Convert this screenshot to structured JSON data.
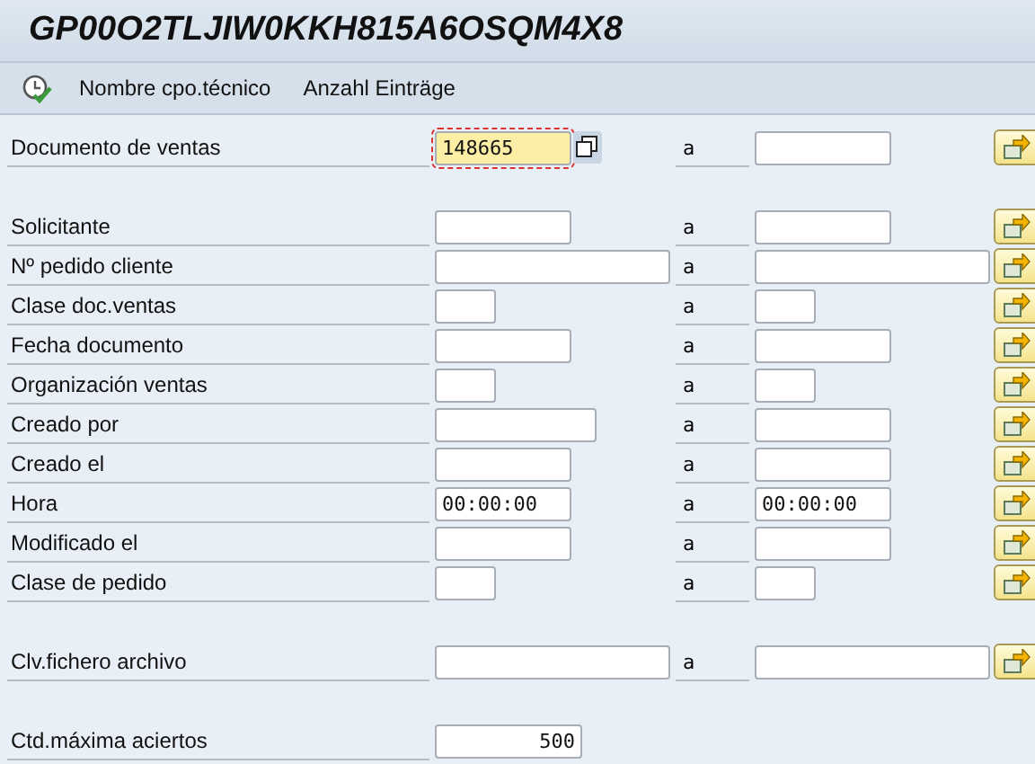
{
  "window": {
    "title": "GP00O2TLJIW0KKH815A6OSQM4X8"
  },
  "toolbar": {
    "items": [
      {
        "kind": "icon"
      },
      {
        "kind": "text",
        "label": "Nombre cpo.técnico"
      },
      {
        "kind": "text",
        "label": "Anzahl Einträge"
      }
    ]
  },
  "sections": [
    {
      "rows": [
        {
          "kind": "range",
          "label": "Documento de ventas",
          "from": "148665",
          "to_label": "a",
          "to": "",
          "focused": true
        }
      ]
    },
    {
      "rows": [
        {
          "kind": "range",
          "label": "Solicitante",
          "from": "",
          "to_label": "a",
          "to": "",
          "focused": false
        },
        {
          "kind": "range",
          "label": "Nº pedido cliente",
          "from": "",
          "to_label": "a",
          "to": "",
          "focused": false
        },
        {
          "kind": "range",
          "label": "Clase doc.ventas",
          "from": "",
          "to_label": "a",
          "to": "",
          "focused": false
        },
        {
          "kind": "range",
          "label": "Fecha documento",
          "from": "",
          "to_label": "a",
          "to": "",
          "focused": false
        },
        {
          "kind": "range",
          "label": "Organización ventas",
          "from": "",
          "to_label": "a",
          "to": "",
          "focused": false
        },
        {
          "kind": "range",
          "label": "Creado por",
          "from": "",
          "to_label": "a",
          "to": "",
          "focused": false
        },
        {
          "kind": "range",
          "label": "Creado el",
          "from": "",
          "to_label": "a",
          "to": "",
          "focused": false
        },
        {
          "kind": "range",
          "label": "Hora",
          "from": "00:00:00",
          "to_label": "a",
          "to": "00:00:00",
          "focused": false
        },
        {
          "kind": "range",
          "label": "Modificado el",
          "from": "",
          "to_label": "a",
          "to": "",
          "focused": false
        },
        {
          "kind": "range",
          "label": "Clase de pedido",
          "from": "",
          "to_label": "a",
          "to": "",
          "focused": false
        }
      ]
    },
    {
      "rows": [
        {
          "kind": "range",
          "label": "Clv.fichero archivo",
          "from": "",
          "to_label": "a",
          "to": "",
          "focused": false
        }
      ]
    },
    {
      "rows": [
        {
          "kind": "single",
          "label": "Ctd.máxima aciertos",
          "from": "500",
          "focused": false
        }
      ]
    }
  ]
}
